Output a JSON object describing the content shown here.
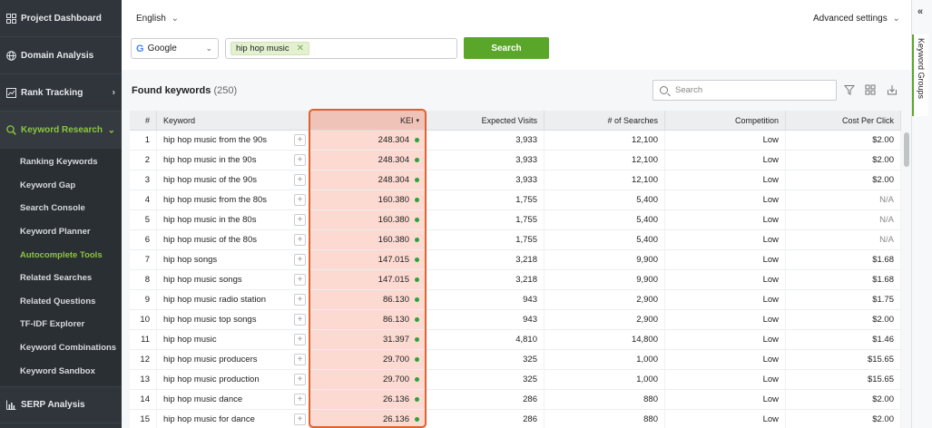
{
  "sidebar": {
    "top": [
      {
        "label": "Project Dashboard",
        "icon": "grid-icon"
      },
      {
        "label": "Domain Analysis",
        "icon": "globe-icon"
      },
      {
        "label": "Rank Tracking",
        "icon": "chart-icon"
      },
      {
        "label": "Keyword Research",
        "icon": "search-icon"
      }
    ],
    "sub": [
      "Ranking Keywords",
      "Keyword Gap",
      "Search Console",
      "Keyword Planner",
      "Autocomplete Tools",
      "Related Searches",
      "Related Questions",
      "TF-IDF Explorer",
      "Keyword Combinations",
      "Keyword Sandbox"
    ],
    "active_sub_index": 4,
    "bottom": {
      "label": "SERP Analysis",
      "icon": "bar-chart-icon"
    }
  },
  "topbar": {
    "language": "English",
    "advanced_settings": "Advanced settings"
  },
  "search": {
    "engine": "Google",
    "keyword_chip": "hip hop music",
    "button": "Search"
  },
  "results": {
    "title": "Found keywords",
    "count": "(250)",
    "filter_placeholder": "Search"
  },
  "table": {
    "headers": {
      "num": "#",
      "keyword": "Keyword",
      "kei": "KEI",
      "visits": "Expected Visits",
      "searches": "# of Searches",
      "competition": "Competition",
      "cpc": "Cost Per Click"
    },
    "rows": [
      {
        "n": "1",
        "kw": "hip hop music from the 90s",
        "kei": "248.304",
        "vis": "3,933",
        "srch": "12,100",
        "comp": "Low",
        "cpc": "$2.00"
      },
      {
        "n": "2",
        "kw": "hip hop music in the 90s",
        "kei": "248.304",
        "vis": "3,933",
        "srch": "12,100",
        "comp": "Low",
        "cpc": "$2.00"
      },
      {
        "n": "3",
        "kw": "hip hop music of the 90s",
        "kei": "248.304",
        "vis": "3,933",
        "srch": "12,100",
        "comp": "Low",
        "cpc": "$2.00"
      },
      {
        "n": "4",
        "kw": "hip hop music from the 80s",
        "kei": "160.380",
        "vis": "1,755",
        "srch": "5,400",
        "comp": "Low",
        "cpc": "N/A"
      },
      {
        "n": "5",
        "kw": "hip hop music in the 80s",
        "kei": "160.380",
        "vis": "1,755",
        "srch": "5,400",
        "comp": "Low",
        "cpc": "N/A"
      },
      {
        "n": "6",
        "kw": "hip hop music of the 80s",
        "kei": "160.380",
        "vis": "1,755",
        "srch": "5,400",
        "comp": "Low",
        "cpc": "N/A"
      },
      {
        "n": "7",
        "kw": "hip hop songs",
        "kei": "147.015",
        "vis": "3,218",
        "srch": "9,900",
        "comp": "Low",
        "cpc": "$1.68"
      },
      {
        "n": "8",
        "kw": "hip hop music songs",
        "kei": "147.015",
        "vis": "3,218",
        "srch": "9,900",
        "comp": "Low",
        "cpc": "$1.68"
      },
      {
        "n": "9",
        "kw": "hip hop music radio station",
        "kei": "86.130",
        "vis": "943",
        "srch": "2,900",
        "comp": "Low",
        "cpc": "$1.75"
      },
      {
        "n": "10",
        "kw": "hip hop music top songs",
        "kei": "86.130",
        "vis": "943",
        "srch": "2,900",
        "comp": "Low",
        "cpc": "$2.00"
      },
      {
        "n": "11",
        "kw": "hip hop music",
        "kei": "31.397",
        "vis": "4,810",
        "srch": "14,800",
        "comp": "Low",
        "cpc": "$1.46"
      },
      {
        "n": "12",
        "kw": "hip hop music producers",
        "kei": "29.700",
        "vis": "325",
        "srch": "1,000",
        "comp": "Low",
        "cpc": "$15.65"
      },
      {
        "n": "13",
        "kw": "hip hop music production",
        "kei": "29.700",
        "vis": "325",
        "srch": "1,000",
        "comp": "Low",
        "cpc": "$15.65"
      },
      {
        "n": "14",
        "kw": "hip hop music dance",
        "kei": "26.136",
        "vis": "286",
        "srch": "880",
        "comp": "Low",
        "cpc": "$2.00"
      },
      {
        "n": "15",
        "kw": "hip hop music for dance",
        "kei": "26.136",
        "vis": "286",
        "srch": "880",
        "comp": "Low",
        "cpc": "$2.00"
      }
    ]
  },
  "right_panel": {
    "label": "Keyword Groups"
  },
  "colors": {
    "accent_green": "#8cc63f",
    "button_green": "#5aa62a",
    "highlight": "#e0622e",
    "kei_bg": "#fcd9d1"
  }
}
